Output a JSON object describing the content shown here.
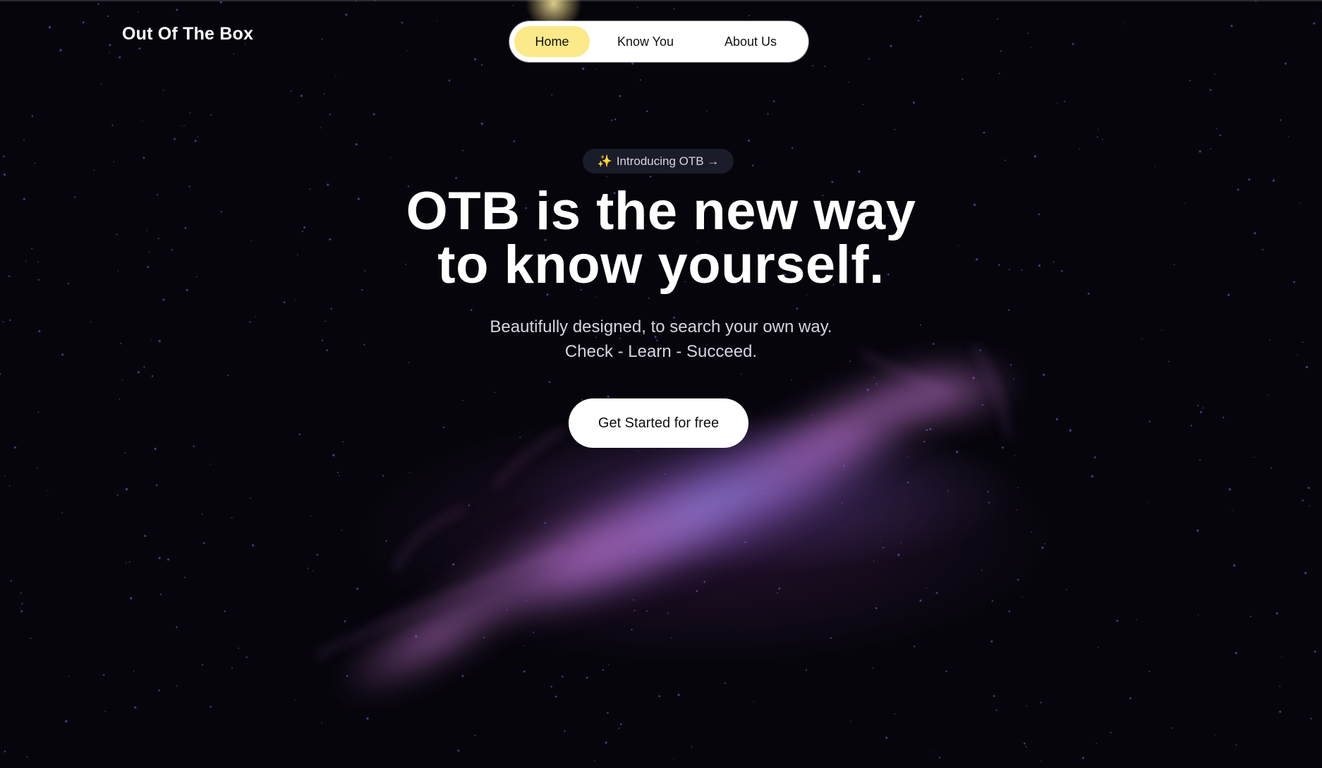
{
  "brand": {
    "name": "Out Of The Box"
  },
  "nav": {
    "items": [
      {
        "label": "Home",
        "active": true
      },
      {
        "label": "Know You",
        "active": false
      },
      {
        "label": "About Us",
        "active": false
      }
    ],
    "active_color": "#fbe98a"
  },
  "hero": {
    "badge": {
      "icon": "sparkle-icon",
      "sparkle": "✨",
      "label": "Introducing OTB →"
    },
    "headline_line1": "OTB is the new way",
    "headline_line2": "to know yourself.",
    "subtitle_line1": "Beautifully designed, to search your own way.",
    "subtitle_line2": "Check - Learn - Succeed.",
    "cta_label": "Get Started for free"
  },
  "colors": {
    "background": "#07050c",
    "nebula_purple": "#b46be0",
    "nebula_blue": "#8a7cf0"
  }
}
